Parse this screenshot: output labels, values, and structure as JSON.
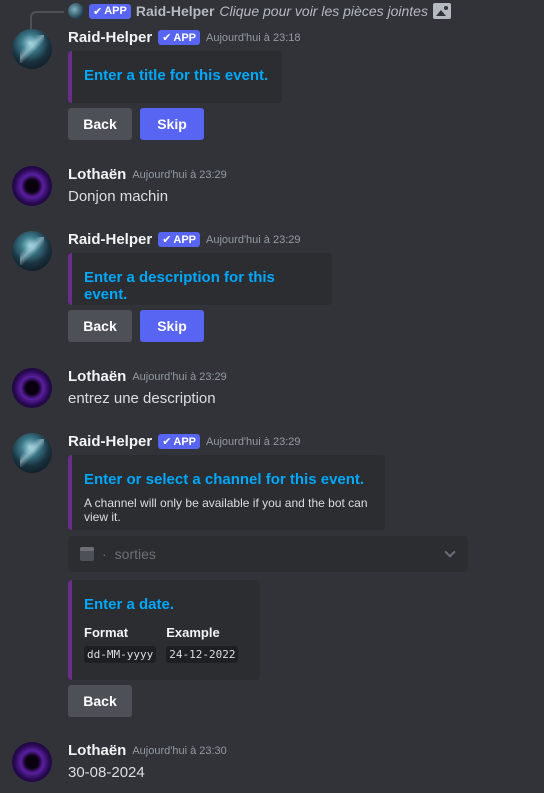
{
  "reply": {
    "badge": "APP",
    "name": "Raid-Helper",
    "text": "Clique pour voir les pièces jointes"
  },
  "messages": [
    {
      "author": "Raid-Helper",
      "badge": "APP",
      "timestamp": "Aujourd'hui à 23:18",
      "embed_title": "Enter a title for this event.",
      "buttons": [
        "Back",
        "Skip"
      ]
    },
    {
      "author": "Lothaën",
      "timestamp": "Aujourd'hui à 23:29",
      "text": "Donjon machin"
    },
    {
      "author": "Raid-Helper",
      "badge": "APP",
      "timestamp": "Aujourd'hui à 23:29",
      "embed_title": "Enter a description for this event.",
      "buttons": [
        "Back",
        "Skip"
      ]
    },
    {
      "author": "Lothaën",
      "timestamp": "Aujourd'hui à 23:29",
      "text": "entrez une description"
    },
    {
      "author": "Raid-Helper",
      "badge": "APP",
      "timestamp": "Aujourd'hui à 23:29",
      "embed_title": "Enter or select a channel for this event.",
      "embed_desc": "A channel will only be available if you and the bot can view it.",
      "select_value": "sorties",
      "date_embed": {
        "title": "Enter a date.",
        "fields": [
          {
            "name": "Format",
            "value": "dd-MM-yyyy"
          },
          {
            "name": "Example",
            "value": "24-12-2022"
          }
        ]
      },
      "buttons": [
        "Back"
      ]
    },
    {
      "author": "Lothaën",
      "timestamp": "Aujourd'hui à 23:30",
      "text": "30-08-2024"
    }
  ],
  "icons": {
    "verified": "checkmark-icon",
    "image": "image-icon",
    "calendar": "calendar-icon",
    "chevron": "chevron-down-icon"
  },
  "colors": {
    "background": "#313338",
    "embed": "#2b2d31",
    "embed_accent": "#6b2d8b",
    "link_blue": "#00a8fc",
    "blurple": "#5865f2",
    "grey_button": "#4e5058"
  }
}
